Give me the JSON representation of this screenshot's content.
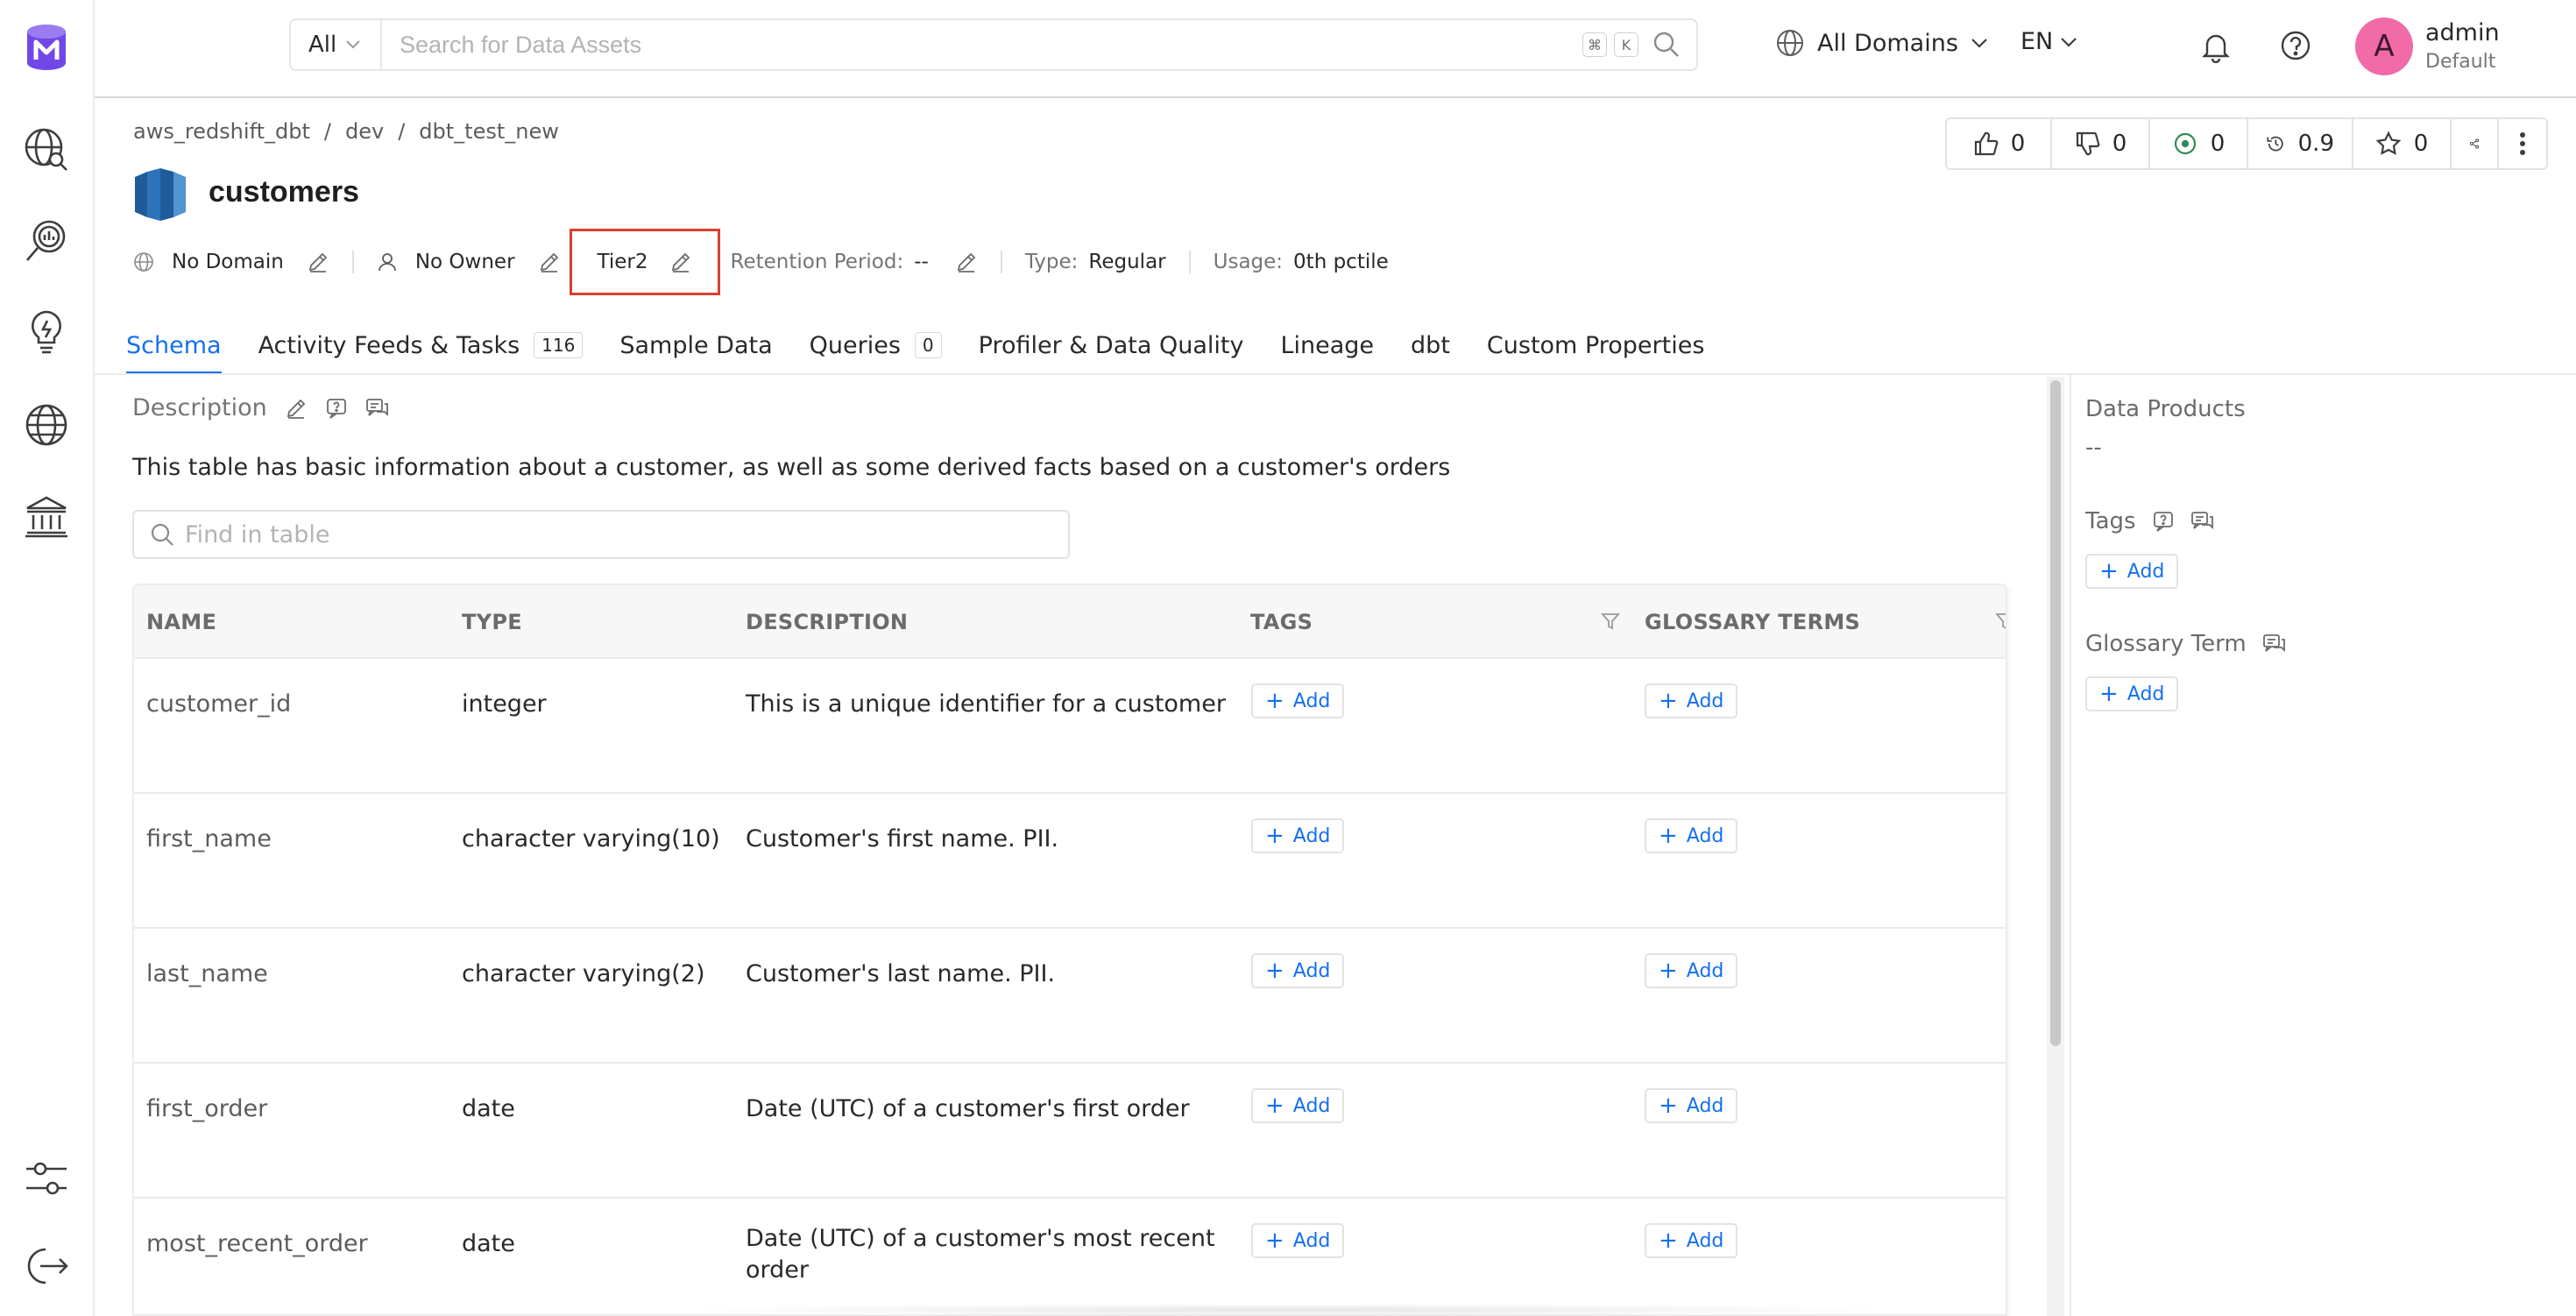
{
  "topbar": {
    "search_scope": "All",
    "search_placeholder": "Search for Data Assets",
    "shortcut_cmd": "⌘",
    "shortcut_key": "K",
    "domains_label": "All Domains",
    "language": "EN",
    "user_initial": "A",
    "user_name": "admin",
    "user_role": "Default"
  },
  "sidebar": {
    "items": [
      "explore-icon",
      "data-quality-icon",
      "insights-icon",
      "domains-icon",
      "governance-icon",
      "settings-icon",
      "logout-icon"
    ]
  },
  "breadcrumb": [
    "aws_redshift_dbt",
    "dev",
    "dbt_test_new"
  ],
  "breadcrumb_sep": "/",
  "entity": {
    "title": "customers"
  },
  "actions": {
    "upvotes": "0",
    "downvotes": "0",
    "conversations": "0",
    "version": "0.9",
    "followers": "0"
  },
  "meta": {
    "domain": "No Domain",
    "owner": "No Owner",
    "tier": "Tier2",
    "retention_label": "Retention Period:",
    "retention_value": "--",
    "type_label": "Type:",
    "type_value": "Regular",
    "usage_label": "Usage:",
    "usage_value": "0th pctile"
  },
  "tabs": [
    {
      "label": "Schema",
      "count": null
    },
    {
      "label": "Activity Feeds & Tasks",
      "count": "116"
    },
    {
      "label": "Sample Data",
      "count": null
    },
    {
      "label": "Queries",
      "count": "0"
    },
    {
      "label": "Profiler & Data Quality",
      "count": null
    },
    {
      "label": "Lineage",
      "count": null
    },
    {
      "label": "dbt",
      "count": null
    },
    {
      "label": "Custom Properties",
      "count": null
    }
  ],
  "description": {
    "heading": "Description",
    "text": "This table has basic information about a customer, as well as some derived facts based on a customer's orders"
  },
  "find": {
    "placeholder": "Find in table"
  },
  "table": {
    "headers": [
      "NAME",
      "TYPE",
      "DESCRIPTION",
      "TAGS",
      "GLOSSARY TERMS"
    ],
    "add_label": "Add",
    "rows": [
      {
        "name": "customer_id",
        "type": "integer",
        "description": "This is a unique identifier for a customer"
      },
      {
        "name": "first_name",
        "type": "character varying(10)",
        "description": "Customer's first name. PII."
      },
      {
        "name": "last_name",
        "type": "character varying(2)",
        "description": "Customer's last name. PII."
      },
      {
        "name": "first_order",
        "type": "date",
        "description": "Date (UTC) of a customer's first order"
      },
      {
        "name": "most_recent_order",
        "type": "date",
        "description": "Date (UTC) of a customer's most recent order"
      }
    ]
  },
  "right_panel": {
    "data_products": "Data Products",
    "data_products_value": "--",
    "tags": "Tags",
    "glossary": "Glossary Term",
    "add_label": "Add"
  },
  "colors": {
    "accent": "#1470ef",
    "tier_highlight": "#d9412f",
    "logo": "#7147e8",
    "avatar": "#f06ba8"
  }
}
